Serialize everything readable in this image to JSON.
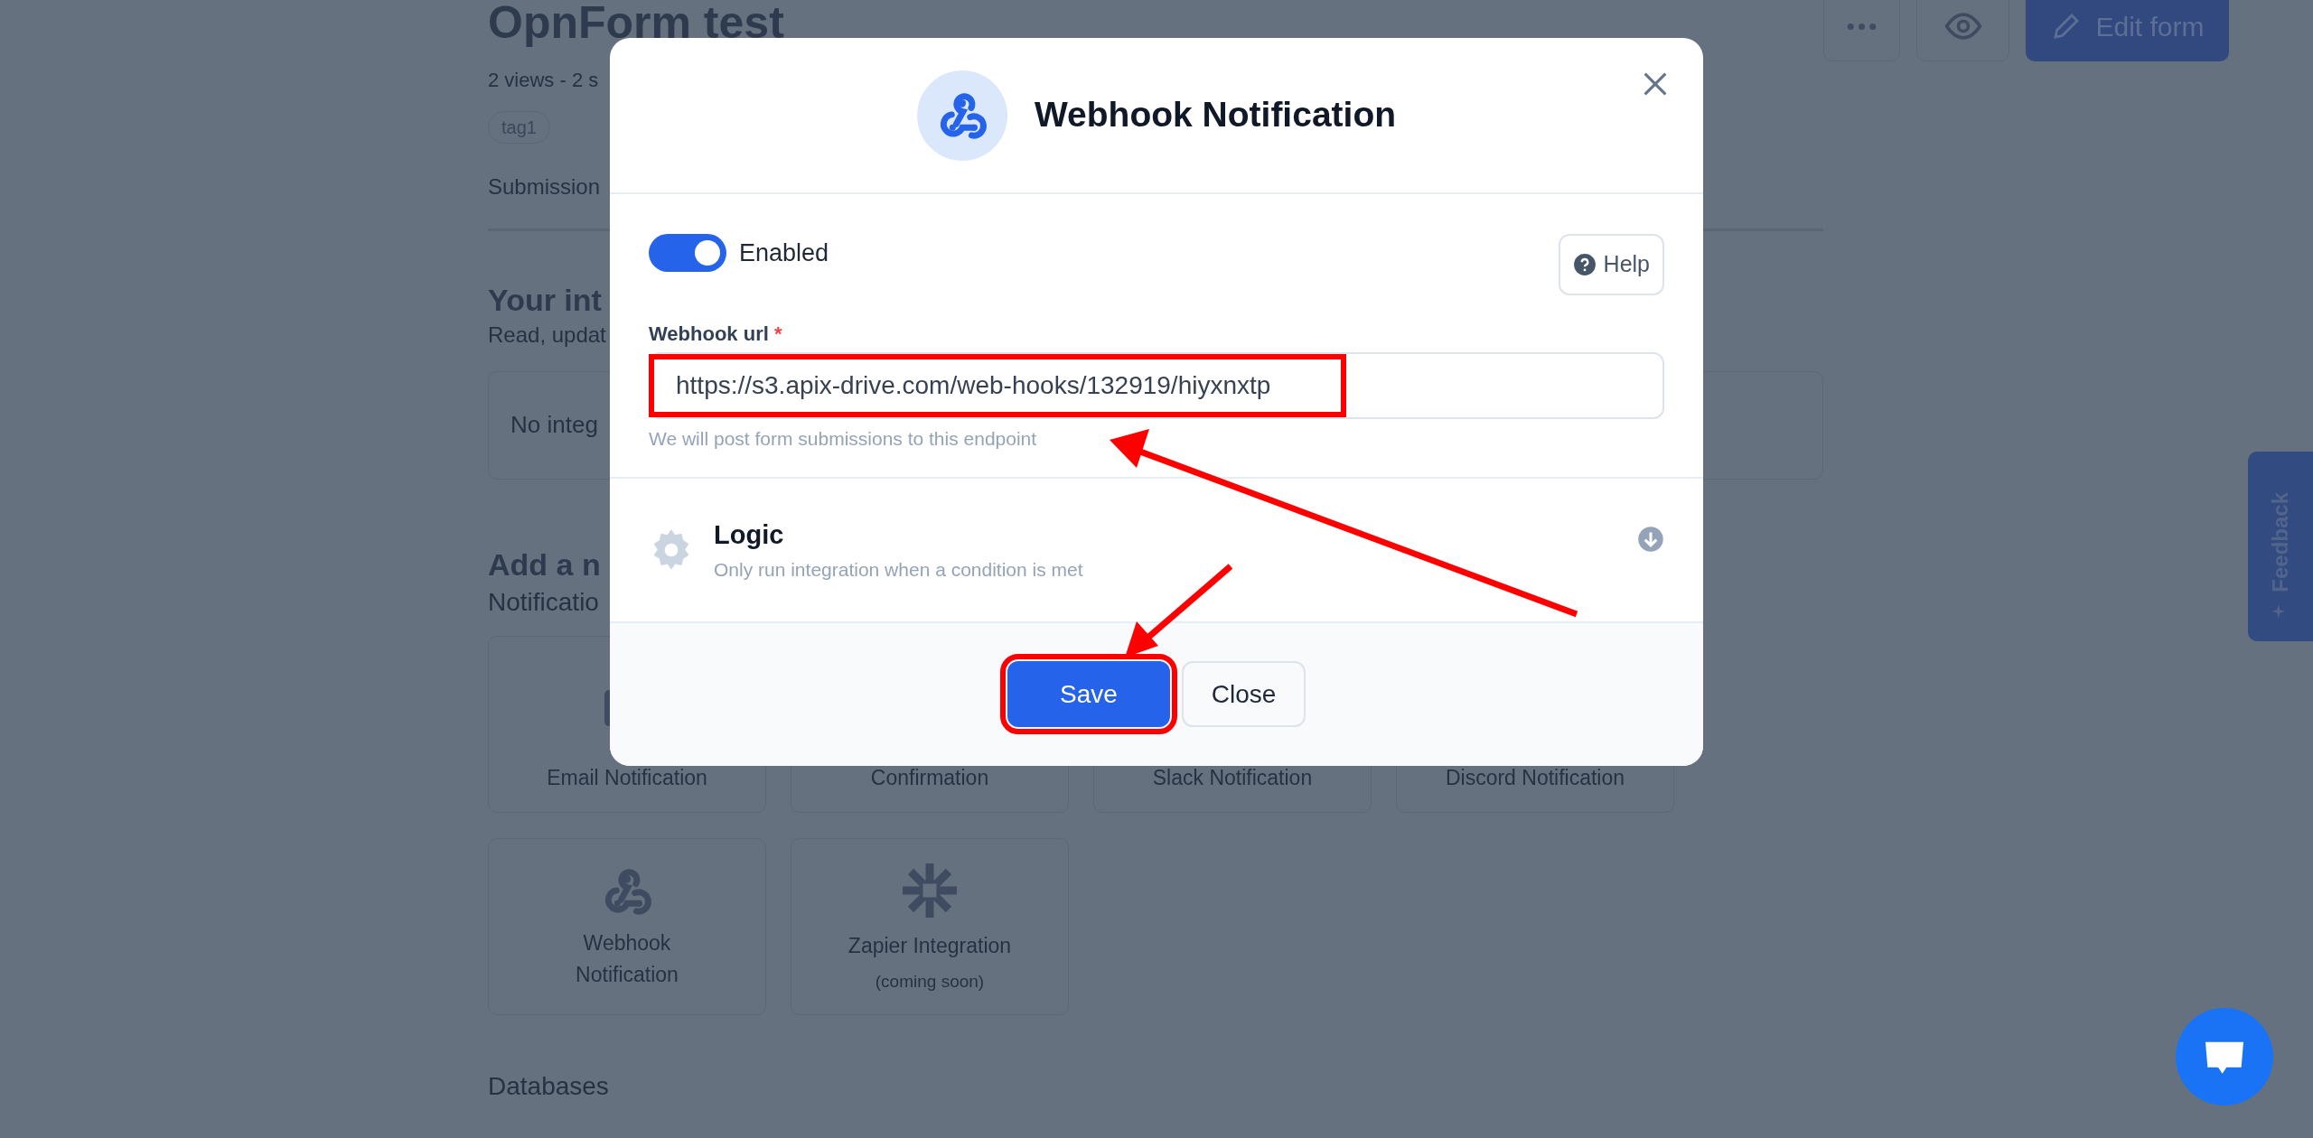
{
  "page": {
    "title": "OpnForm test",
    "stats": "2 views - 2 s",
    "tags": [
      "tag1"
    ],
    "tab": "Submission",
    "edit_button": "Edit form"
  },
  "integrations": {
    "title": "Your int",
    "subtitle": "Read, updat",
    "empty": "No integ"
  },
  "add_section": {
    "title": "Add a n",
    "subtitle": "Notificatio",
    "cards": [
      {
        "kind": "email",
        "lines": [
          "Email Notification"
        ]
      },
      {
        "kind": "plain",
        "lines": [
          "Confirmation"
        ]
      },
      {
        "kind": "plain",
        "lines": [
          "Slack Notification"
        ]
      },
      {
        "kind": "plain",
        "lines": [
          "Discord Notification"
        ]
      },
      {
        "kind": "webhook",
        "lines": [
          "Webhook",
          "Notification"
        ]
      },
      {
        "kind": "zapier",
        "lines": [
          "Zapier Integration"
        ],
        "note": "(coming soon)"
      }
    ]
  },
  "databases": "Databases",
  "feedback": "Feedback",
  "modal": {
    "title": "Webhook Notification",
    "enabled": {
      "label": "Enabled",
      "on": true
    },
    "help": "Help",
    "url_field": {
      "label": "Webhook url",
      "required_mark": "*",
      "value": "https://s3.apix-drive.com/web-hooks/132919/hiyxnxtp",
      "hint": "We will post form submissions to this endpoint",
      "highlighted": true
    },
    "logic": {
      "title": "Logic",
      "subtitle": "Only run integration when a condition is met"
    },
    "buttons": [
      {
        "label": "Save",
        "kind": "primary",
        "highlighted": true
      },
      {
        "label": "Close",
        "kind": "secondary",
        "highlighted": false
      }
    ]
  }
}
